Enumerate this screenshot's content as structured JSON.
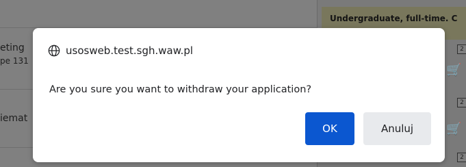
{
  "background": {
    "rows": [
      "eting",
      "pe 131",
      "iemat"
    ],
    "notice": "Undergraduate, full-time. C",
    "box_labels": [
      "2",
      "2",
      "2"
    ]
  },
  "dialog": {
    "origin": "usosweb.test.sgh.waw.pl",
    "message": "Are you sure you want to withdraw your application?",
    "ok_label": "OK",
    "cancel_label": "Anuluj"
  },
  "colors": {
    "ok_button": "#0b57d0",
    "cancel_button": "#e8eaed",
    "overlay": "#808080"
  }
}
